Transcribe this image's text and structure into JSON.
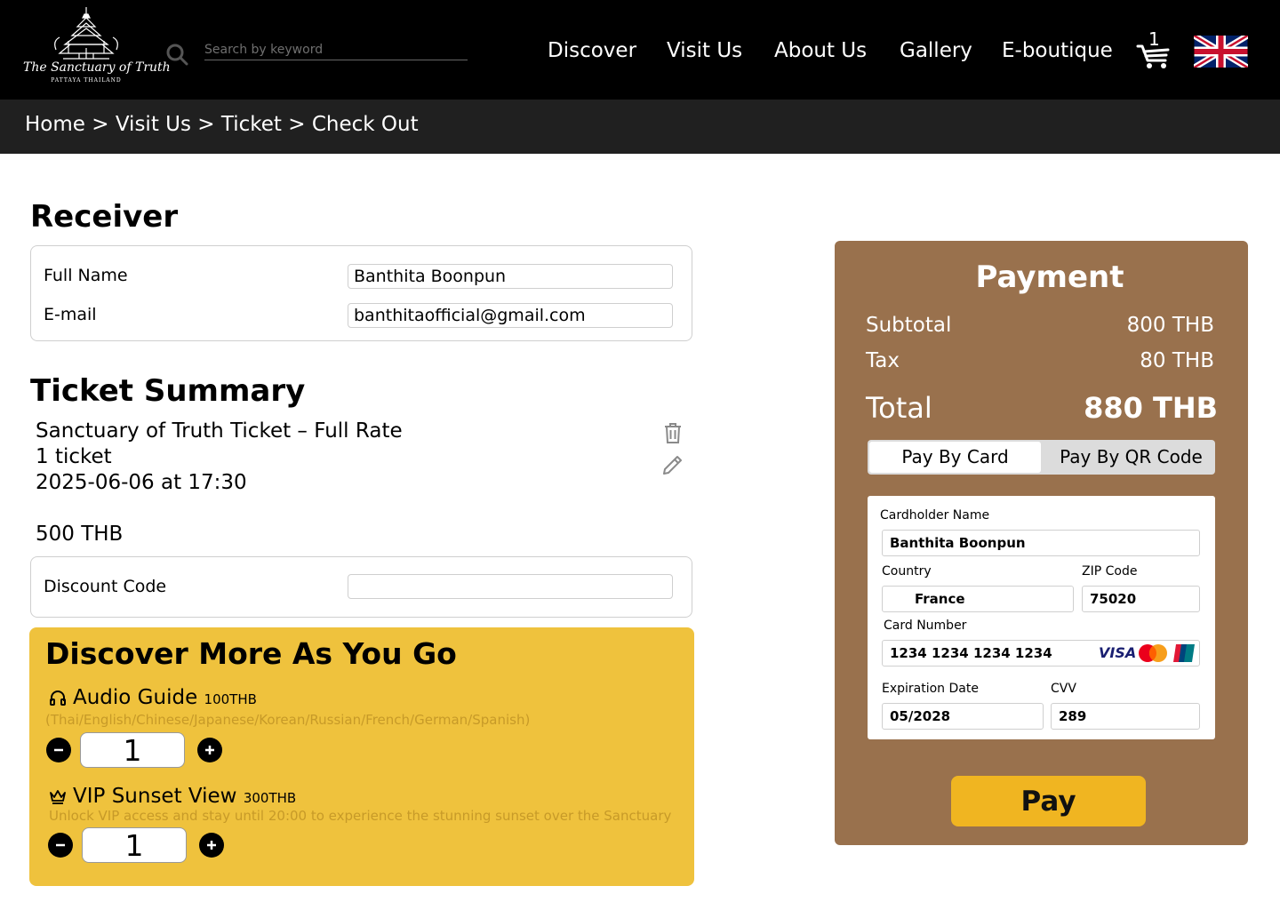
{
  "header": {
    "logo_script": "The Sanctuary of Truth",
    "logo_sub": "PATTAYA THAILAND",
    "search_placeholder": "Search by keyword",
    "nav": [
      "Discover",
      "Visit Us",
      "About Us",
      "Gallery",
      "E-boutique"
    ],
    "cart_count": "1"
  },
  "breadcrumb": [
    "Home",
    "Visit Us",
    "Ticket",
    "Check Out"
  ],
  "breadcrumb_sep": ">",
  "receiver": {
    "title": "Receiver",
    "name_label": "Full Name",
    "name_value": "Banthita Boonpun",
    "email_label": "E-mail",
    "email_value": "banthitaofficial@gmail.com"
  },
  "ticket_summary": {
    "title": "Ticket Summary",
    "ticket_name": "Sanctuary of Truth Ticket – Full Rate",
    "quantity": "1 ticket",
    "datetime": "2025-06-06 at 17:30",
    "price": "500 THB",
    "discount_label": "Discount Code",
    "discount_value": ""
  },
  "discover_more": {
    "title": "Discover More As You Go",
    "addons": [
      {
        "name": "Audio Guide",
        "price": "100THB",
        "description": "(Thai/English/Chinese/Japanese/Korean/Russian/French/German/Spanish)",
        "quantity": "1"
      },
      {
        "name": "VIP Sunset View",
        "price": "300THB",
        "description": "Unlock VIP access and stay until 20:00 to experience the stunning sunset over the Sanctuary",
        "quantity": "1"
      }
    ]
  },
  "payment": {
    "title": "Payment",
    "subtotal_label": "Subtotal",
    "subtotal_value": "800 THB",
    "tax_label": "Tax",
    "tax_value": "80 THB",
    "total_label": "Total",
    "total_value": "880 THB",
    "tabs": [
      "Pay By Card",
      "Pay By QR Code"
    ],
    "cardholder_label": "Cardholder Name",
    "cardholder_value": "Banthita Boonpun",
    "country_label": "Country",
    "country_value": "France",
    "zip_label": "ZIP Code",
    "zip_value": "75020",
    "card_number_label": "Card Number",
    "card_number_value": "1234 1234 1234 1234",
    "card_brands": [
      "VISA",
      "mastercard",
      "unionpay"
    ],
    "expiry_label": "Expiration Date",
    "expiry_value": "05/2028",
    "cvv_label": "CVV",
    "cvv_value": "289",
    "pay_button": "Pay"
  },
  "colors": {
    "header_bg": "#000000",
    "breadcrumb_bg": "#202020",
    "payment_bg": "#99714d",
    "discover_bg": "#efc23d",
    "pay_button_bg": "#f0b521"
  }
}
